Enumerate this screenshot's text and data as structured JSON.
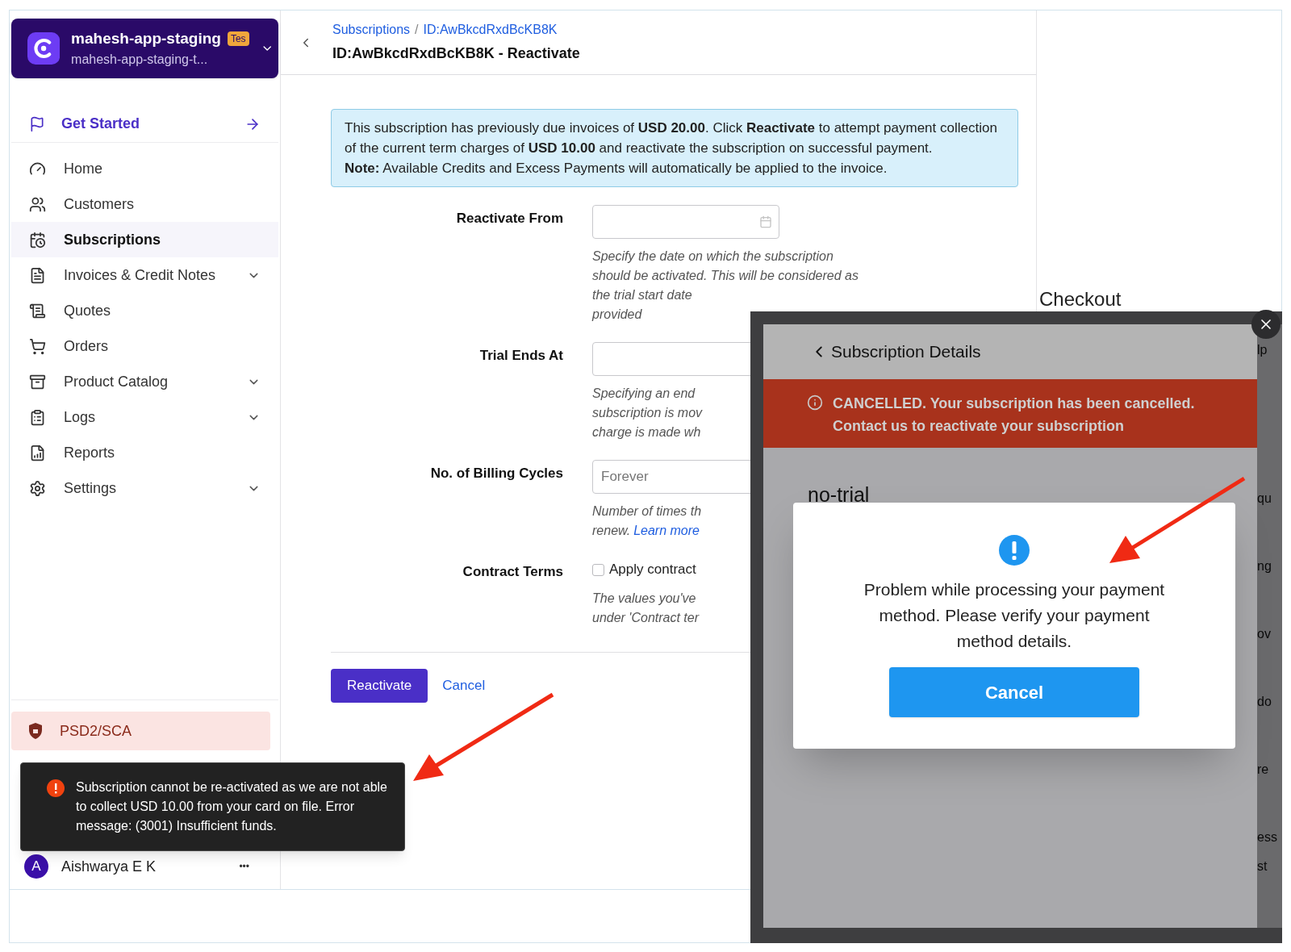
{
  "workspace": {
    "name": "mahesh-app-staging",
    "badge": "Tes",
    "subtitle": "mahesh-app-staging-t..."
  },
  "get_started": {
    "label": "Get Started"
  },
  "nav": [
    {
      "label": "Home",
      "selected": false,
      "expandable": false
    },
    {
      "label": "Customers",
      "selected": false,
      "expandable": false
    },
    {
      "label": "Subscriptions",
      "selected": true,
      "expandable": false
    },
    {
      "label": "Invoices & Credit Notes",
      "selected": false,
      "expandable": true
    },
    {
      "label": "Quotes",
      "selected": false,
      "expandable": false
    },
    {
      "label": "Orders",
      "selected": false,
      "expandable": false
    },
    {
      "label": "Product Catalog",
      "selected": false,
      "expandable": true
    },
    {
      "label": "Logs",
      "selected": false,
      "expandable": true
    },
    {
      "label": "Reports",
      "selected": false,
      "expandable": false
    },
    {
      "label": "Settings",
      "selected": false,
      "expandable": true
    }
  ],
  "sidebar_footer": {
    "psd2": "PSD2/SCA",
    "user_initial": "A",
    "user_name": "Aishwarya E K",
    "more": "•••"
  },
  "breadcrumb": [
    "Subscriptions",
    "ID:AwBkcdRxdBcKB8K"
  ],
  "breadcrumb_separator": "/",
  "page_title": "ID:AwBkcdRxdBcKB8K - Reactivate",
  "notice": {
    "text": "This subscription has previously due invoices of **USD 20.00**. Click **Reactivate** to attempt payment collection of the current term charges of **USD 10.00** and reactivate the subscription on successful payment.",
    "note": "**Note:** Available Credits and Excess Payments will automatically be applied to the invoice."
  },
  "form": [
    {
      "kind": "date",
      "label": "Reactivate From",
      "hint_lines": [
        "Specify the date on which the subscription",
        "should be activated. This will be considered as",
        "the trial start date",
        "provided"
      ]
    },
    {
      "kind": "text",
      "label": "Trial Ends At",
      "hint_lines": [
        "Specifying an end",
        "subscription is mov",
        "charge is made wh"
      ]
    },
    {
      "kind": "text",
      "label": "No. of Billing Cycles",
      "placeholder": "Forever",
      "hint_lines": [
        "Number of times th",
        "renew."
      ],
      "link": "Learn more"
    },
    {
      "kind": "checkbox",
      "label": "Contract Terms",
      "checkbox_label": "Apply contract",
      "checked": false,
      "hint_lines": [
        "The values you've",
        "under 'Contract ter"
      ]
    }
  ],
  "actions": {
    "primary": "Reactivate",
    "secondary": "Cancel"
  },
  "toast": {
    "message": "Subscription cannot be re-activated as we are not able to collect USD 10.00 from your card on file. Error message: (3001) Insufficient funds."
  },
  "checkout": {
    "title": "Checkout",
    "back_label": "Subscription Details",
    "banner": "CANCELLED. Your subscription has been cancelled. Contact us to reactivate your subscription",
    "plan": "no-trial",
    "dialog": {
      "message": "Problem while processing your payment method. Please verify your payment method details.",
      "button": "Cancel"
    },
    "fragments": [
      "lp",
      "qu",
      "ng",
      "ov",
      "do",
      "re",
      "ess",
      "st"
    ]
  }
}
